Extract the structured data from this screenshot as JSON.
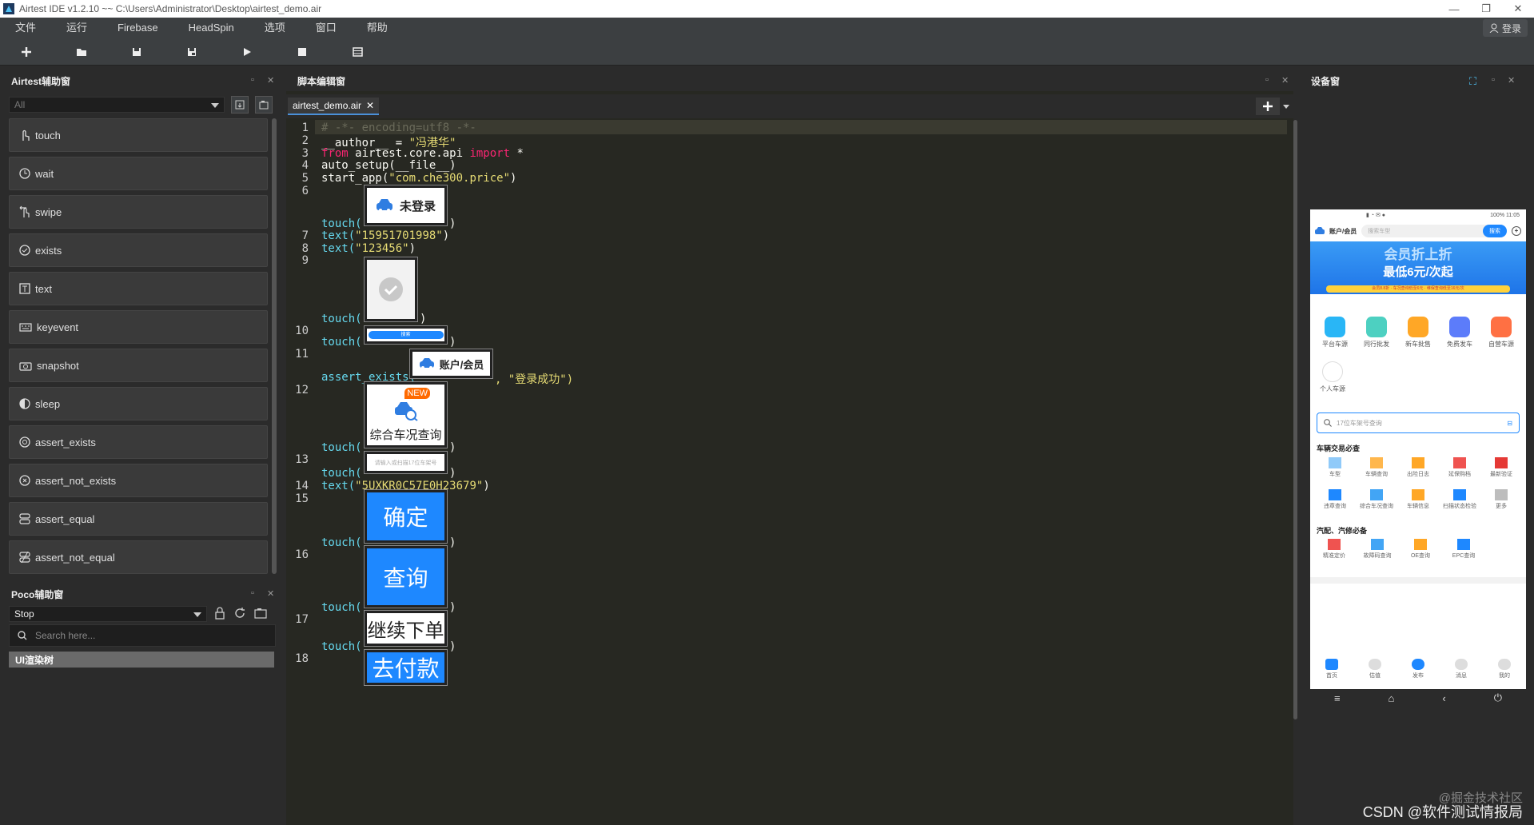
{
  "window": {
    "title": "Airtest IDE v1.2.10 ~~ C:\\Users\\Administrator\\Desktop\\airtest_demo.air",
    "minimize": "—",
    "maximize": "❐",
    "close": "✕"
  },
  "menu": [
    "文件",
    "运行",
    "Firebase",
    "HeadSpin",
    "选项",
    "窗口",
    "帮助"
  ],
  "login_label": "登录",
  "toolbar_icons": [
    "new-file-icon",
    "open-folder-icon",
    "save-icon",
    "save-as-icon",
    "run-icon",
    "stop-icon",
    "log-icon"
  ],
  "airtest_panel": {
    "title": "Airtest辅助窗",
    "filter": "All",
    "apis": [
      "touch",
      "wait",
      "swipe",
      "exists",
      "text",
      "keyevent",
      "snapshot",
      "sleep",
      "assert_exists",
      "assert_not_exists",
      "assert_equal",
      "assert_not_equal"
    ]
  },
  "poco_panel": {
    "title": "Poco辅助窗",
    "mode": "Stop",
    "search_placeholder": "Search here...",
    "tree_header": "UI渲染树"
  },
  "editor": {
    "title": "脚本编辑窗",
    "tab": "airtest_demo.air",
    "line_numbers": [
      "1",
      "2",
      "3",
      "4",
      "5",
      "6",
      "7",
      "8",
      "9",
      "10",
      "11",
      "12",
      "13",
      "14",
      "15",
      "16",
      "17",
      "18"
    ],
    "code": {
      "l1": "# -*- encoding=utf8 -*-",
      "l2a": "__author__ = ",
      "l2b": "\"冯港华\"",
      "l3a": "from",
      "l3b": " airtest.core.api ",
      "l3c": "import",
      "l3d": " *",
      "l4": "auto_setup(__file__)",
      "l5a": "start_app(",
      "l5b": "\"com.che300.price\"",
      "l5c": ")",
      "touch": "touch(",
      "close_paren": ")",
      "text": "text(",
      "l7": "\"15951701998\"",
      "l8": "\"123456\"",
      "assert_exists": "assert_exists(",
      "assert_msg": ", \"登录成功\")",
      "l14": "\"5UXKR0C57E0H23679\""
    },
    "snapshots": {
      "s6": "未登录",
      "s10": "搜索",
      "s11": "账户/会员",
      "s12_badge": "NEW",
      "s12": "综合车况查询",
      "s13": "请输入或扫描17位车架号",
      "s15": "确定",
      "s16": "查询",
      "s17": "继续下单",
      "s18": "去付款"
    }
  },
  "device_panel": {
    "title": "设备窗",
    "phone": {
      "status_right": "100% 11:05",
      "header_left": "账户/会员",
      "search_placeholder": "搜索车型",
      "search_button": "搜索",
      "banner_line1": "会员折上折",
      "banner_line2": "最低6元/次起",
      "banner_sub": "会员8.8折 · 车况查询低至6元 · 维保查询低至16元/次",
      "top_icons": [
        "平台车源",
        "同行批发",
        "新车批售",
        "免费发车",
        "自营车源"
      ],
      "personal": "个人车源",
      "vin_placeholder": "17位车架号查询",
      "sec1": "车辆交易必查",
      "sec1_items_r1": [
        "车型",
        "车辆查询",
        "出险日志",
        "延保购档",
        "最新验证"
      ],
      "sec1_items_r2": [
        "违章查询",
        "综合车况查询",
        "车辆信息",
        "扫描状态检验",
        "更多"
      ],
      "sec2": "汽配、汽修必备",
      "sec2_items": [
        "精准定价",
        "故障码查询",
        "OE查询",
        "EPC查询"
      ],
      "bottom_tabs": [
        "首页",
        "估值",
        "发布",
        "消息",
        "我的"
      ]
    }
  },
  "watermark": {
    "line1": "@掘金技术社区",
    "line2": "CSDN @软件测试情报局"
  },
  "colors": {
    "accent": "#1e88ff",
    "editor_bg": "#272822",
    "panel_bg": "#2b2b2b",
    "toolbar_bg": "#3c3f41"
  }
}
